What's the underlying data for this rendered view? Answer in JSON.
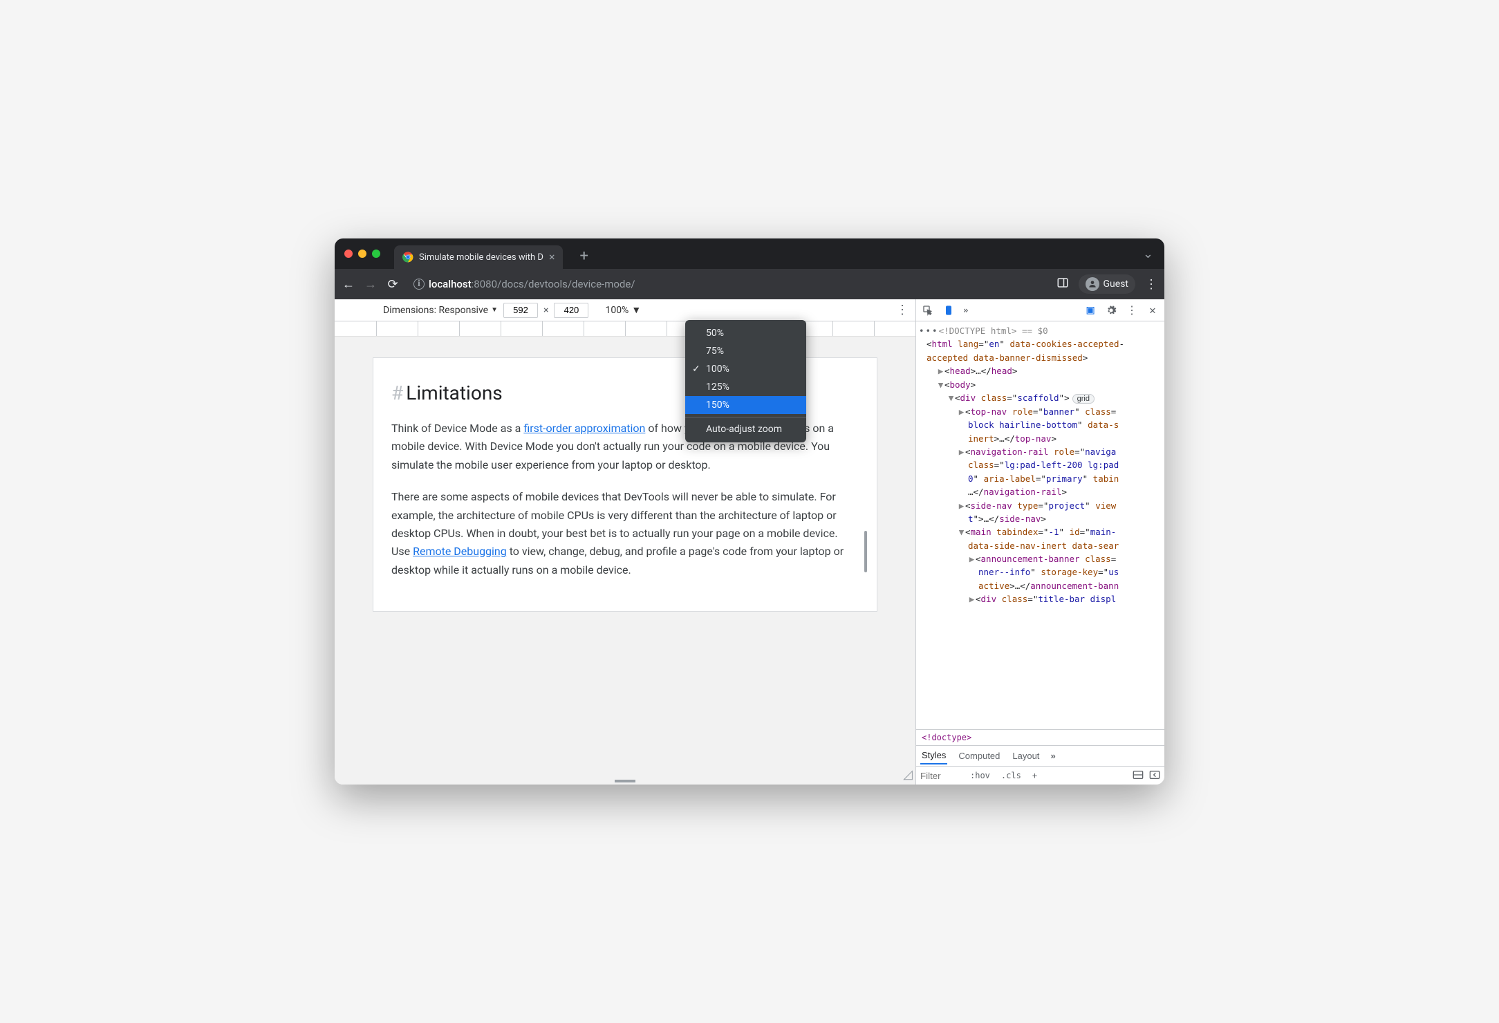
{
  "window": {
    "tab_title": "Simulate mobile devices with D"
  },
  "omnibox": {
    "host": "localhost",
    "port": ":8080",
    "path": "/docs/devtools/device-mode/"
  },
  "toolbar": {
    "guest_label": "Guest"
  },
  "device_toolbar": {
    "dimensions_label": "Dimensions: Responsive",
    "width": "592",
    "height": "420",
    "x_symbol": "×",
    "zoom_label": "100%"
  },
  "zoom_menu": {
    "items": [
      "50%",
      "75%",
      "100%",
      "125%",
      "150%"
    ],
    "checked_index": 2,
    "selected_index": 4,
    "auto_label": "Auto-adjust zoom"
  },
  "page": {
    "heading_hash": "#",
    "heading": "Limitations",
    "p1a": "Think of Device Mode as a ",
    "p1_link": "first-order approximation",
    "p1b": " of how your page looks and feels on a mobile device. With Device Mode you don't actually run your code on a mobile device. You simulate the mobile user experience from your laptop or desktop.",
    "p2a": "There are some aspects of mobile devices that DevTools will never be able to simulate. For example, the architecture of mobile CPUs is very different than the architecture of laptop or desktop CPUs. When in doubt, your best bet is to actually run your page on a mobile device. Use ",
    "p2_link": "Remote Debugging",
    "p2b": " to view, change, debug, and profile a page's code from your laptop or desktop while it actually runs on a mobile device."
  },
  "devtools": {
    "breadcrumb": "!doctype",
    "line_doctype_a": "<!DOCTYPE html>",
    "line_doctype_b": " == $0",
    "styles_tabs": [
      "Styles",
      "Computed",
      "Layout"
    ],
    "filter_placeholder": "Filter",
    "hov_label": ":hov",
    "cls_label": ".cls",
    "grid_label": "grid",
    "tree": {
      "html_open": "<html",
      "html_attr1": "lang",
      "html_attr1v": "en",
      "html_attr2": "data-cookies-accepted",
      "html_attr3": "data-banner-dismissed",
      "head_open": "<head>",
      "head_ell": "…",
      "head_close": "</head>",
      "body_open": "<body>",
      "div_open": "<div",
      "div_class": "class",
      "div_class_v": "scaffold",
      "topnav_open": "<top-nav",
      "role": "role",
      "banner": "banner",
      "topnav_class_v": "block hairline-bottom",
      "data_s": "data-s",
      "inert": "inert",
      "topnav_close": "</top-nav>",
      "navrail_open": "<navigation-rail",
      "naviga": "naviga",
      "navrail_class_v": "lg:pad-left-200 lg:pad",
      "zero": "0",
      "aria_label": "aria-label",
      "primary": "primary",
      "tabin": "tabin",
      "navrail_close": "</navigation-rail>",
      "sidenav_open": "<side-nav",
      "type": "type",
      "project": "project",
      "view": "view",
      "tclose": "t\">",
      "sidenav_close": "</side-nav>",
      "main_open": "<main",
      "tabindex": "tabindex",
      "neg1": "-1",
      "id": "id",
      "main_id": "main-",
      "main_attr": "data-side-nav-inert data-sear",
      "ann_open": "<announcement-banner",
      "ann_class_v": "nner--info",
      "storage_key": "storage-key",
      "us": "us",
      "active": "active",
      "ann_close": "</announcement-bann",
      "title_div": "<div",
      "title_class_v": "title-bar displ"
    }
  }
}
